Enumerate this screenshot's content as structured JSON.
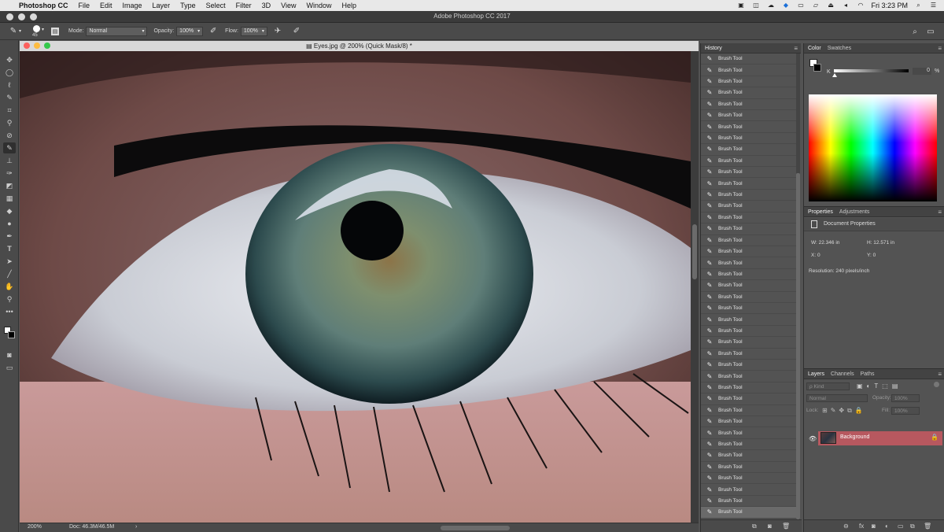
{
  "menubar": {
    "apple": "",
    "app_name": "Photoshop CC",
    "items": [
      "File",
      "Edit",
      "Image",
      "Layer",
      "Type",
      "Select",
      "Filter",
      "3D",
      "View",
      "Window",
      "Help"
    ],
    "clock": "Fri 3:23 PM",
    "status_icons": [
      "camera-icon",
      "screen-mirror-icon",
      "cloud-icon",
      "dropbox-icon",
      "drive-icon",
      "airplay-icon",
      "eject-icon",
      "volume-icon",
      "wifi-icon",
      "search-icon",
      "list-icon"
    ]
  },
  "titlebar": {
    "title": "Adobe Photoshop CC 2017"
  },
  "options": {
    "brush_size": "45",
    "mode_label": "Mode:",
    "mode_value": "Normal",
    "opacity_label": "Opacity:",
    "opacity_value": "100%",
    "flow_label": "Flow:",
    "flow_value": "100%"
  },
  "document": {
    "title": "Eyes.jpg @ 200% (Quick Mask/8) *",
    "zoom": "200%",
    "doc_size": "Doc: 46.3M/46.5M",
    "arrow": "›"
  },
  "history": {
    "title": "History",
    "item_label": "Brush Tool",
    "row_count": 41
  },
  "color_panel": {
    "tabs": [
      "Color",
      "Swatches"
    ],
    "k_label": "K",
    "k_value": "0",
    "k_unit": "%",
    "foreground": "#ffffff",
    "background": "#000000"
  },
  "properties": {
    "tabs": [
      "Properties",
      "Adjustments"
    ],
    "header": "Document Properties",
    "w": "W: 22.346 in",
    "h": "H: 12.571 in",
    "x": "X: 0",
    "y": "Y: 0",
    "resolution": "Resolution: 240 pixels/inch"
  },
  "layers": {
    "tabs": [
      "Layers",
      "Channels",
      "Paths"
    ],
    "kind_label": "ρ Kind",
    "blend_mode": "Normal",
    "opacity_label": "Opacity:",
    "opacity_value": "100%",
    "lock_label": "Lock:",
    "fill_label": "Fill:",
    "fill_value": "100%",
    "layer_name": "Background",
    "selected_color": "#b7585f"
  }
}
